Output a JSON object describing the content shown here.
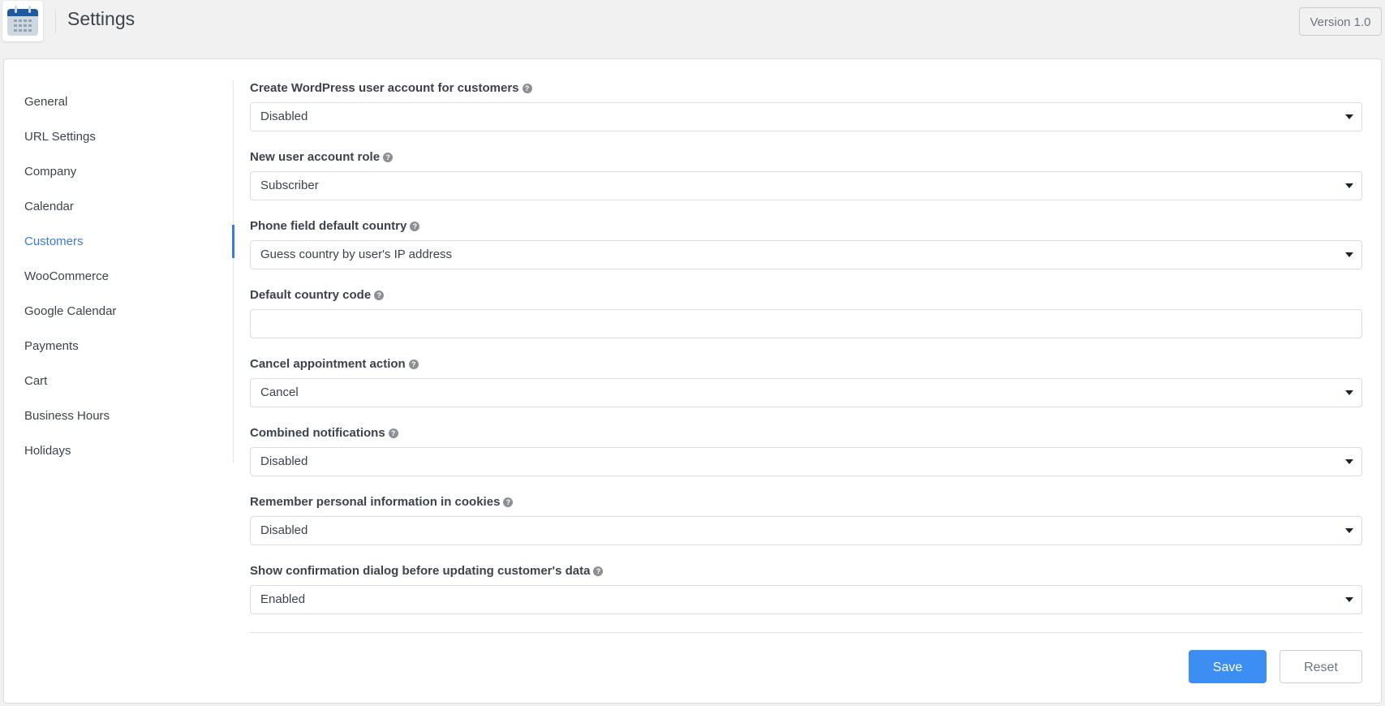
{
  "header": {
    "title": "Settings",
    "logo_icon": "calendar-icon",
    "version_label": "Version 1.0"
  },
  "sidebar": {
    "items": [
      {
        "label": "General",
        "active": false
      },
      {
        "label": "URL Settings",
        "active": false
      },
      {
        "label": "Company",
        "active": false
      },
      {
        "label": "Calendar",
        "active": false
      },
      {
        "label": "Customers",
        "active": true
      },
      {
        "label": "WooCommerce",
        "active": false
      },
      {
        "label": "Google Calendar",
        "active": false
      },
      {
        "label": "Payments",
        "active": false
      },
      {
        "label": "Cart",
        "active": false
      },
      {
        "label": "Business Hours",
        "active": false
      },
      {
        "label": "Holidays",
        "active": false
      }
    ]
  },
  "form": {
    "fields": [
      {
        "label": "Create WordPress user account for customers",
        "type": "select",
        "value": "Disabled"
      },
      {
        "label": "New user account role",
        "type": "select",
        "value": "Subscriber"
      },
      {
        "label": "Phone field default country",
        "type": "select",
        "value": "Guess country by user's IP address"
      },
      {
        "label": "Default country code",
        "type": "text",
        "value": "",
        "placeholder": ""
      },
      {
        "label": "Cancel appointment action",
        "type": "select",
        "value": "Cancel"
      },
      {
        "label": "Combined notifications",
        "type": "select",
        "value": "Disabled"
      },
      {
        "label": "Remember personal information in cookies",
        "type": "select",
        "value": "Disabled"
      },
      {
        "label": "Show confirmation dialog before updating customer's data",
        "type": "select",
        "value": "Enabled"
      }
    ],
    "help_icon_glyph": "?"
  },
  "actions": {
    "save_label": "Save",
    "reset_label": "Reset"
  },
  "colors": {
    "accent": "#3a7bd5",
    "save_button": "#3c8ef3"
  }
}
